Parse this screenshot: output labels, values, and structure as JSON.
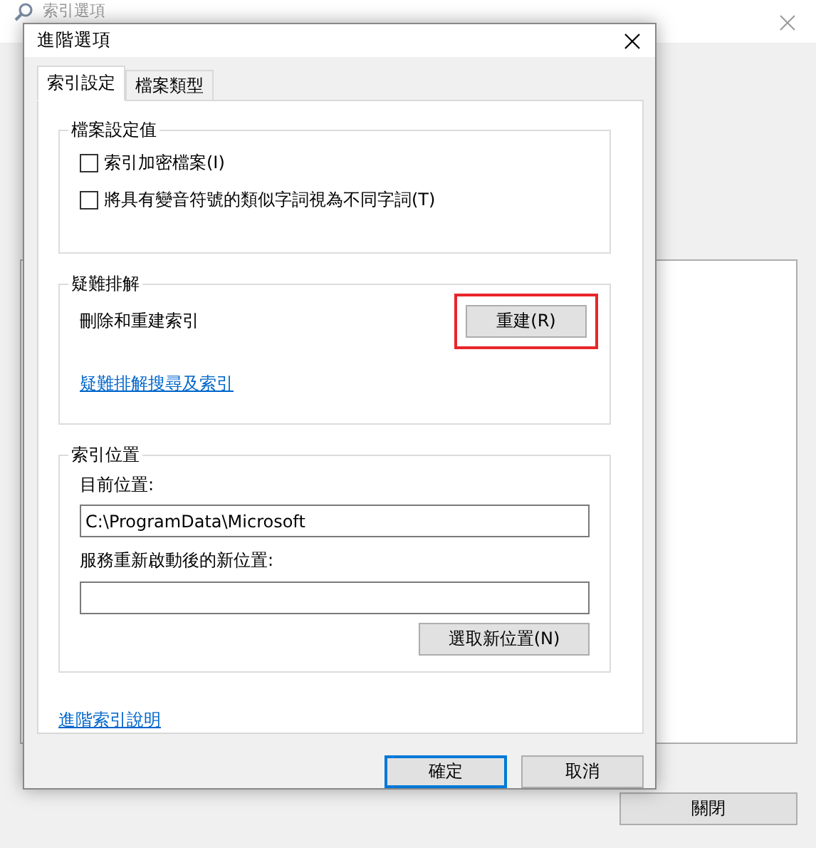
{
  "background_window": {
    "title": "索引選項",
    "close_button": "關閉"
  },
  "dialog": {
    "title": "進階選項",
    "tabs": [
      {
        "label": "索引設定",
        "selected": true
      },
      {
        "label": "檔案類型",
        "selected": false
      }
    ],
    "file_settings": {
      "title": "檔案設定值",
      "options": [
        {
          "label": "索引加密檔案(I)",
          "checked": false
        },
        {
          "label": "將具有變音符號的類似字詞視為不同字詞(T)",
          "checked": false
        }
      ]
    },
    "troubleshooting": {
      "title": "疑難排解",
      "description": "刪除和重建索引",
      "rebuild_button": {
        "label": "重建(R)",
        "highlighted": true
      },
      "link": "疑難排解搜尋及索引"
    },
    "index_location": {
      "title": "索引位置",
      "current_label": "目前位置:",
      "current_value": "C:\\ProgramData\\Microsoft",
      "new_label": "服務重新啟動後的新位置:",
      "select_button": "選取新位置(N)"
    },
    "help_link": "進階索引說明",
    "buttons": [
      {
        "label": "確定",
        "default": true
      },
      {
        "label": "取消",
        "default": false
      }
    ]
  }
}
